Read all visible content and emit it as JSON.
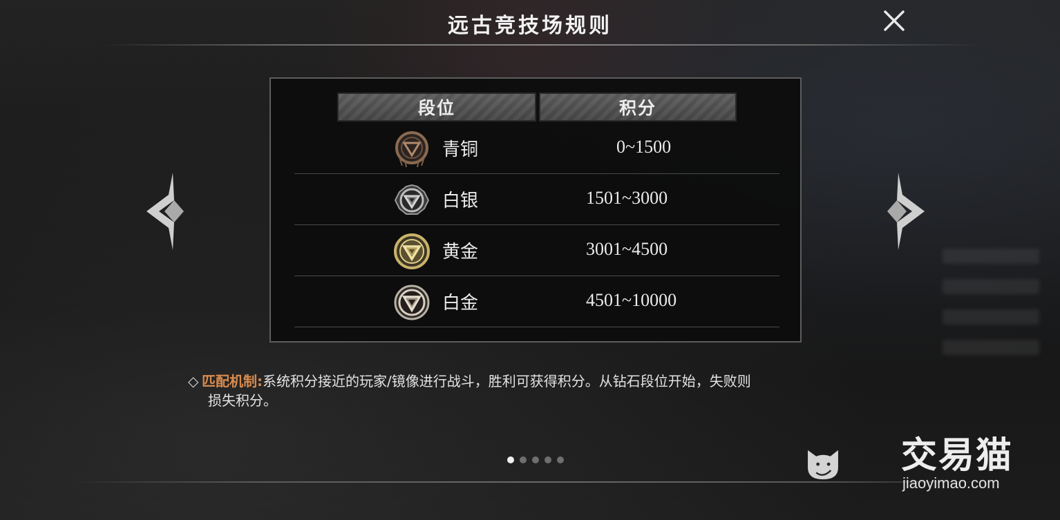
{
  "title": "远古竞技场规则",
  "table": {
    "headers": [
      "段位",
      "积分"
    ],
    "rows": [
      {
        "rank": "青铜",
        "score": "0~1500",
        "icon": "bronze-badge-icon",
        "color": "#8a6a52"
      },
      {
        "rank": "白银",
        "score": "1501~3000",
        "icon": "silver-badge-icon",
        "color": "#9a9a9a"
      },
      {
        "rank": "黄金",
        "score": "3001~4500",
        "icon": "gold-badge-icon",
        "color": "#c9b26b"
      },
      {
        "rank": "白金",
        "score": "4501~10000",
        "icon": "platinum-badge-icon",
        "color": "#b9b2a6"
      }
    ]
  },
  "description": {
    "label": "匹配机制:",
    "line1": "系统积分接近的玩家/镜像进行战斗，胜利可获得积分。从钻石段位开始，失败则",
    "line2": "损失积分。"
  },
  "pagination": {
    "total": 5,
    "current": 1
  },
  "watermark": {
    "name": "交易猫",
    "url": "jiaoyimao.com"
  },
  "colors": {
    "accent": "#d98b4e",
    "text": "#ececec"
  }
}
